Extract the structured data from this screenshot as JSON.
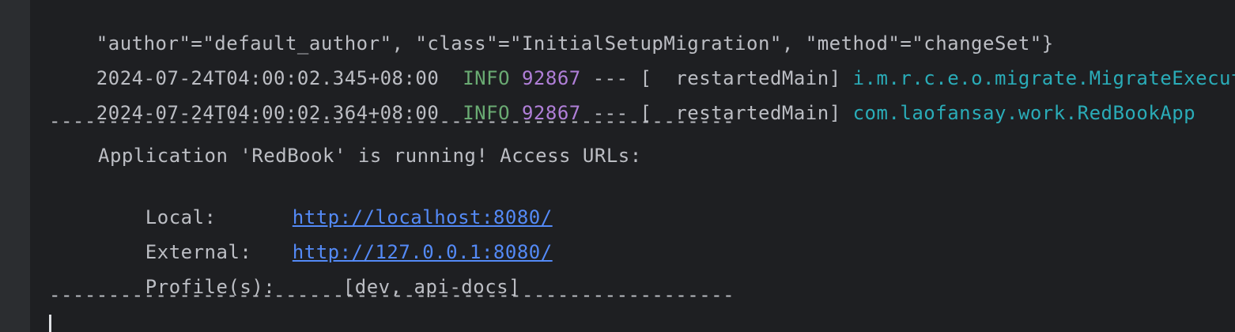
{
  "log": {
    "line0": "\"author\"=\"default_author\", \"class\"=\"InitialSetupMigration\", \"method\"=\"changeSet\"}",
    "entries": [
      {
        "timestamp": "2024-07-24T04:00:02.345+08:00",
        "level": "INFO",
        "pid": "92867",
        "dashes": "---",
        "thread": "[  restartedMain]",
        "logger": "i.m.r.c.e.o.migrate.MigrateExecut"
      },
      {
        "timestamp": "2024-07-24T04:00:02.364+08:00",
        "level": "INFO",
        "pid": "92867",
        "dashes": "---",
        "thread": "[  restartedMain]",
        "logger": "com.laofansay.work.RedBookApp"
      }
    ],
    "separator": "----------------------------------------------------------",
    "banner": {
      "running": "Application 'RedBook' is running! Access URLs:",
      "local_label": "Local:",
      "local_url": "http://localhost:8080/",
      "external_label": "External:",
      "external_url": "http://127.0.0.1:8080/",
      "profiles_label": "Profile(s):",
      "profiles_value": "[dev, api-docs]"
    }
  },
  "colors": {
    "background": "#1e1f22",
    "text": "#bcbec4",
    "info": "#6aab73",
    "pid": "#b07fd8",
    "logger": "#2aacb8",
    "link": "#548af7"
  }
}
